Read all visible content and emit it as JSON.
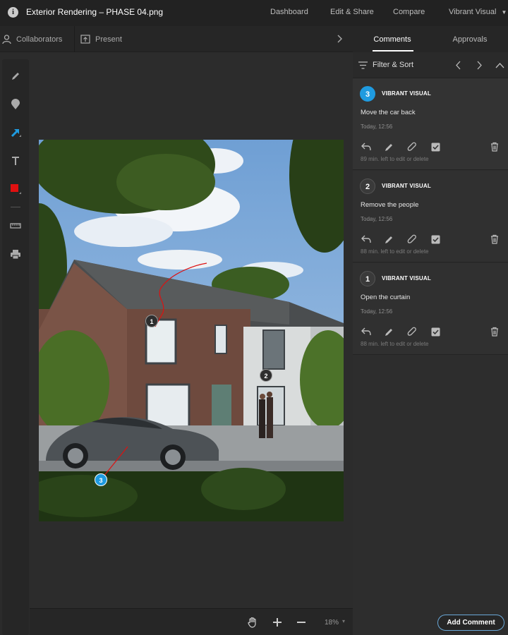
{
  "header": {
    "title": "Exterior Rendering  –  PHASE 04.png",
    "nav": [
      "Dashboard",
      "Edit & Share",
      "Compare",
      "Vibrant Visual"
    ]
  },
  "subbar": {
    "collaborators": "Collaborators",
    "present": "Present"
  },
  "tools": [
    "pencil-icon",
    "marker-icon",
    "arrow-icon",
    "text-icon",
    "color-swatch",
    "ruler-icon",
    "print-icon"
  ],
  "accent": "#1f9be0",
  "panel": {
    "tabs": [
      "Comments",
      "Approvals"
    ],
    "filter_label": "Filter & Sort",
    "comments": [
      {
        "number": "3",
        "author": "VIBRANT VISUAL",
        "text": "Move the car back",
        "time": "Today, 12:56",
        "note": "89 min. left to edit or delete"
      },
      {
        "number": "2",
        "author": "VIBRANT VISUAL",
        "text": "Remove the people",
        "time": "Today, 12:56",
        "note": "88 min. left to edit or delete"
      },
      {
        "number": "1",
        "author": "VIBRANT VISUAL",
        "text": "Open the curtain",
        "time": "Today, 12:56",
        "note": "88 min. left to edit or delete"
      }
    ],
    "add_button": "Add Comment"
  },
  "zoom": {
    "value": "18%",
    "dropdown": "▾"
  },
  "pins": [
    "1",
    "2",
    "3"
  ]
}
